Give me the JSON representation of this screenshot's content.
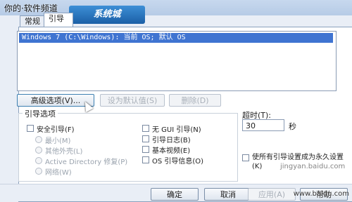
{
  "watermark": {
    "text": "你的·软件频道",
    "logo": "系统城",
    "mid": "jingyan.baidu.com",
    "bottom": "www.baidu.com"
  },
  "tabs": [
    {
      "label": "常规"
    },
    {
      "label": "引导"
    }
  ],
  "os_list": {
    "items": [
      "Windows 7 (C:\\Windows): 当前 OS; 默认 OS"
    ]
  },
  "buttons": {
    "advanced": "高级选项(V)...",
    "set_default": "设为默认值(S)",
    "delete": "删除(D)",
    "ok": "确定",
    "cancel": "取消",
    "apply": "应用(A)",
    "help": "帮助"
  },
  "boot_options": {
    "legend": "引导选项",
    "safe_boot": "安全引导(F)",
    "minimal": "最小(M)",
    "alternate_shell": "其他外壳(L)",
    "active_directory": "Active Directory 修复(P)",
    "network": "网络(W)",
    "no_gui": "无 GUI 引导(N)",
    "boot_log": "引导日志(B)",
    "base_video": "基本视频(E)",
    "os_info": "OS 引导信息(O)"
  },
  "timeout": {
    "label": "超时(T):",
    "value": "30",
    "unit": "秒"
  },
  "permanent": {
    "label": "使所有引导设置成为永久设置(K)"
  }
}
